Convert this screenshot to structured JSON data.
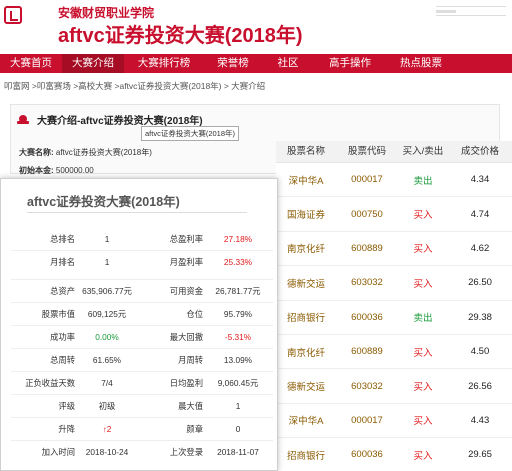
{
  "header": {
    "school": "安徽财贸职业学院",
    "contest_title": "aftvc证券投资大赛(2018年)"
  },
  "nav": {
    "items": [
      "大赛首页",
      "大赛介绍",
      "大赛排行榜",
      "荣誉榜",
      "社区",
      "高手操作",
      "热点股票"
    ],
    "active_index": 1
  },
  "breadcrumb": "叩富网 >叩富赛场 >高校大赛 >aftvc证券投资大赛(2018年) > 大赛介绍",
  "intro": {
    "title": "大赛介绍-aftvc证券投资大赛(2018年)",
    "tooltip": "aftvc证券投资大赛(2018年)",
    "name_label": "大赛名称:",
    "name_value": "aftvc证券投资大赛(2018年)",
    "capital_label": "初始本金:",
    "capital_value": "500000.00"
  },
  "stocks": {
    "headers": [
      "股票名称",
      "股票代码",
      "买入/卖出",
      "成交价格"
    ],
    "rows": [
      {
        "name": "深中华A",
        "code": "000017",
        "action": "卖出",
        "price": "4.34"
      },
      {
        "name": "国海证券",
        "code": "000750",
        "action": "买入",
        "price": "4.74"
      },
      {
        "name": "南京化纤",
        "code": "600889",
        "action": "买入",
        "price": "4.62"
      },
      {
        "name": "德新交运",
        "code": "603032",
        "action": "买入",
        "price": "26.50"
      },
      {
        "name": "招商银行",
        "code": "600036",
        "action": "卖出",
        "price": "29.38"
      },
      {
        "name": "南京化纤",
        "code": "600889",
        "action": "买入",
        "price": "4.50"
      },
      {
        "name": "德新交运",
        "code": "603032",
        "action": "买入",
        "price": "26.56"
      },
      {
        "name": "深中华A",
        "code": "000017",
        "action": "买入",
        "price": "4.43"
      },
      {
        "name": "招商银行",
        "code": "600036",
        "action": "买入",
        "price": "29.65"
      }
    ]
  },
  "card": {
    "title": "aftvc证券投资大赛(2018年)",
    "rows": [
      [
        "总排名",
        "1",
        "总盈利率",
        "27.18%"
      ],
      [
        "月排名",
        "1",
        "月盈利率",
        "25.33%"
      ],
      [
        "总资产",
        "635,906.77元",
        "可用资金",
        "26,781.77元"
      ],
      [
        "股票市值",
        "609,125元",
        "仓位",
        "95.79%"
      ],
      [
        "成功率",
        "0.00%",
        "最大回撤",
        "-5.31%"
      ],
      [
        "总周转",
        "61.65%",
        "月周转",
        "13.09%"
      ],
      [
        "正负收益天数",
        "7/4",
        "日均盈利",
        "9,060.45元"
      ],
      [
        "评级",
        "初级",
        "晨大值",
        "1"
      ],
      [
        "升降",
        "↑2",
        "颜章",
        "0"
      ],
      [
        "加入时间",
        "2018-10-24",
        "上次登录",
        "2018-11-07"
      ]
    ]
  },
  "colors": {
    "brand": "#c8102e",
    "buy": "#e0191a",
    "sell": "#1a9a3a"
  }
}
